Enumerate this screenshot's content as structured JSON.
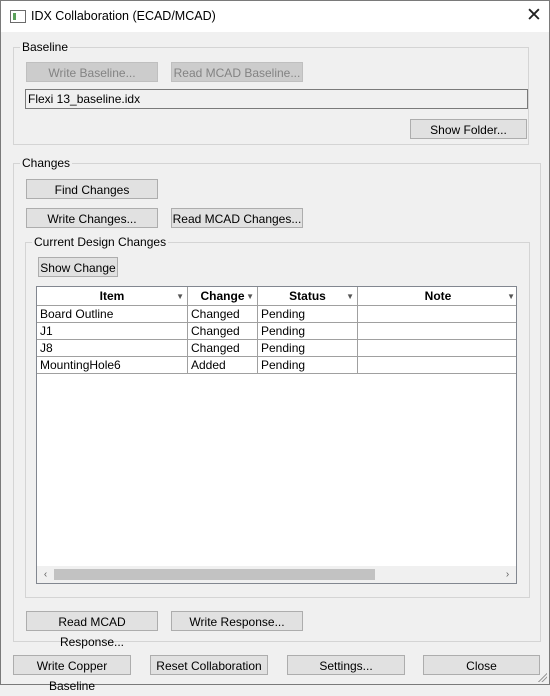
{
  "window": {
    "title": "IDX Collaboration (ECAD/MCAD)",
    "app_icon": "window-icon",
    "close_icon": "close-icon",
    "close_glyph": "✕"
  },
  "baseline": {
    "legend": "Baseline",
    "write_baseline": "Write Baseline...",
    "read_mcad_baseline": "Read MCAD Baseline...",
    "file_value": "Flexi 13_baseline.idx",
    "show_folder": "Show Folder..."
  },
  "changes": {
    "legend": "Changes",
    "find_changes": "Find Changes",
    "write_changes": "Write Changes...",
    "read_mcad_changes": "Read MCAD Changes...",
    "read_mcad_response": "Read MCAD Response...",
    "write_response": "Write Response..."
  },
  "current_design_changes": {
    "legend": "Current Design Changes",
    "show_change": "Show Change",
    "columns": [
      "Item",
      "Change",
      "Status",
      "Note"
    ],
    "rows": [
      {
        "item": "Board Outline",
        "change": "Changed",
        "status": "Pending",
        "note": ""
      },
      {
        "item": "J1",
        "change": "Changed",
        "status": "Pending",
        "note": ""
      },
      {
        "item": "J8",
        "change": "Changed",
        "status": "Pending",
        "note": ""
      },
      {
        "item": "MountingHole6",
        "change": "Added",
        "status": "Pending",
        "note": ""
      }
    ],
    "sort_glyph": "▼",
    "scroll_left_glyph": "‹",
    "scroll_right_glyph": "›"
  },
  "footer": {
    "write_copper_baseline": "Write Copper Baseline",
    "reset_collaboration": "Reset Collaboration",
    "settings": "Settings...",
    "close": "Close"
  }
}
